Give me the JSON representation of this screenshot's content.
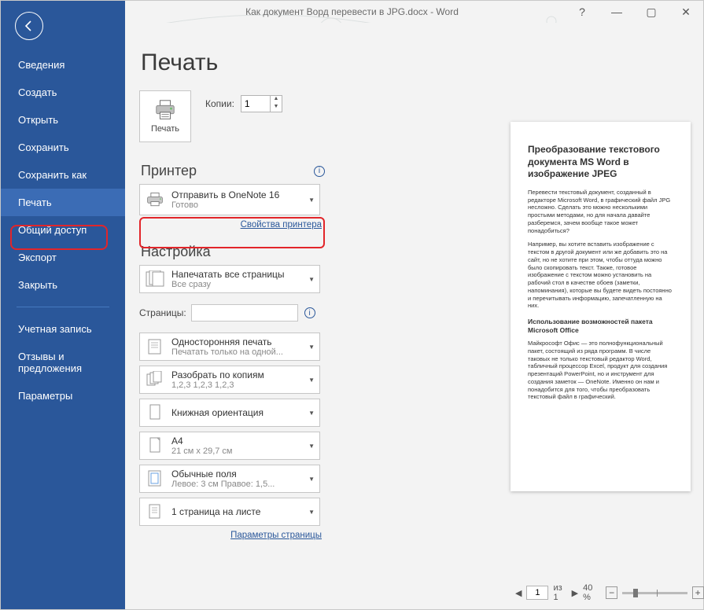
{
  "title": "Как документ Ворд перевести в JPG.docx  -  Word",
  "sidebar": [
    "Сведения",
    "Создать",
    "Открыть",
    "Сохранить",
    "Сохранить как",
    "Печать",
    "Общий доступ",
    "Экспорт",
    "Закрыть"
  ],
  "sidebar2": [
    "Учетная запись",
    "Отзывы и предложения",
    "Параметры"
  ],
  "page_heading": "Печать",
  "print_btn": "Печать",
  "copies_label": "Копии:",
  "copies_value": "1",
  "printer_hdr": "Принтер",
  "printer": {
    "name": "Отправить в OneNote 16",
    "status": "Готово"
  },
  "printer_link": "Свойства принтера",
  "settings_hdr": "Настройка",
  "settings": [
    {
      "id": "scope",
      "line1": "Напечатать все страницы",
      "line2": "Все сразу"
    },
    {
      "id": "sides",
      "line1": "Односторонняя печать",
      "line2": "Печатать только на одной..."
    },
    {
      "id": "collate",
      "line1": "Разобрать по копиям",
      "line2": "1,2,3    1,2,3    1,2,3"
    },
    {
      "id": "orient",
      "line1": "Книжная ориентация",
      "line2": ""
    },
    {
      "id": "size",
      "line1": "A4",
      "line2": "21 см x 29,7 см"
    },
    {
      "id": "margins",
      "line1": "Обычные поля",
      "line2": "Левое:  3 см   Правое:  1,5..."
    },
    {
      "id": "sheet",
      "line1": "1 страница на листе",
      "line2": ""
    }
  ],
  "pages_label": "Страницы:",
  "page_setup_link": "Параметры страницы",
  "preview": {
    "title": "Преобразование текстового документа MS Word в изображение JPEG",
    "p1": "Перевести текстовый документ, созданный в редакторе Microsoft Word, в графический файл JPG несложно. Сделать это можно несколькими простыми методами, но для начала давайте разберемся, зачем вообще такое может понадобиться?",
    "p2": "Например, вы хотите вставить изображение с текстом в другой документ или же добавить это на сайт, но не хотите при этом, чтобы оттуда можно было скопировать текст. Также, готовое изображение с текстом можно установить на рабочий стол в качестве обоев (заметки, напоминания), которые вы будете видеть постоянно и перечитывать информацию, запечатленную на них.",
    "sub": "Использование возможностей пакета Microsoft Office",
    "p3": "Майкрософт Офис — это полнофункциональный пакет, состоящий из ряда программ. В числе таковых не только текстовый редактор Word, табличный процессор Excel, продукт для создания презентаций PowerPoint, но и инструмент для создания заметок — OneNote. Именно он нам и понадобится для того, чтобы преобразовать текстовый файл в графический."
  },
  "footer": {
    "page": "1",
    "of": "из 1",
    "zoom": "40 %"
  }
}
